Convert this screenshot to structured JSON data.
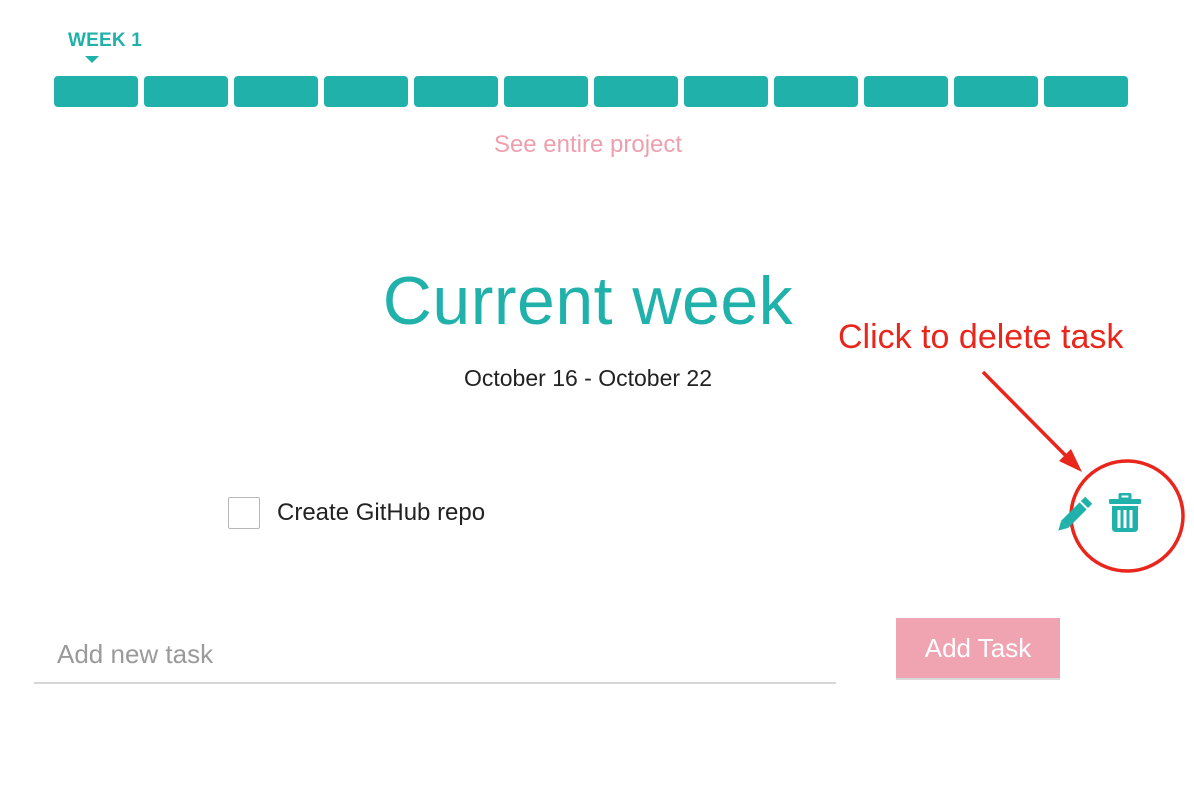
{
  "header": {
    "current_week_label": "WEEK 1",
    "timeline_week_count": 12,
    "see_project_link": "See entire project"
  },
  "main": {
    "title": "Current week",
    "date_range": "October 16 - October 22"
  },
  "tasks": [
    {
      "label": "Create GitHub repo",
      "checked": false
    }
  ],
  "task_actions": {
    "edit_icon": "pencil-icon",
    "delete_icon": "trash-icon"
  },
  "new_task": {
    "placeholder": "Add new task",
    "value": ""
  },
  "add_task_button": {
    "label": "Add Task"
  },
  "annotation": {
    "text": "Click to delete task"
  },
  "colors": {
    "accent_teal": "#20b2aa",
    "accent_pink": "#ee9fae",
    "button_pink": "#f0a3b0",
    "annotation_red": "#e8261c"
  }
}
